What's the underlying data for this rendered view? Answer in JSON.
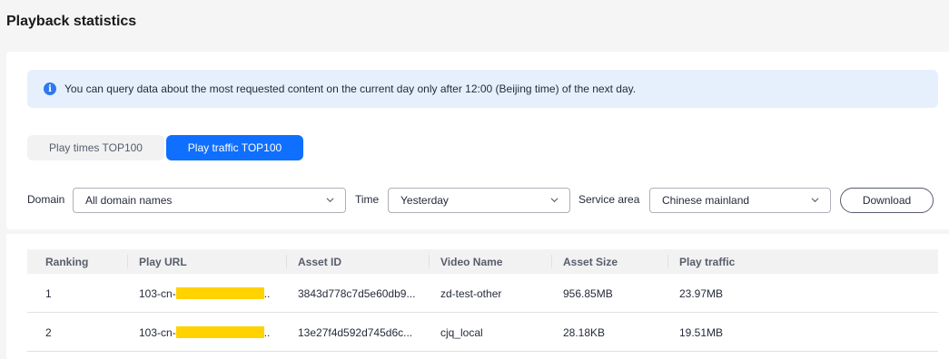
{
  "page": {
    "title": "Playback statistics"
  },
  "notice": {
    "icon": "info-icon",
    "text": "You can query data about the most requested content on the current day only after 12:00 (Beijing time) of the next day."
  },
  "tabs": [
    {
      "label": "Play times TOP100",
      "active": false
    },
    {
      "label": "Play traffic TOP100",
      "active": true
    }
  ],
  "filters": {
    "domain_label": "Domain",
    "domain_value": "All domain names",
    "time_label": "Time",
    "time_value": "Yesterday",
    "area_label": "Service area",
    "area_value": "Chinese mainland",
    "download_label": "Download"
  },
  "table": {
    "columns": [
      "Ranking",
      "Play URL",
      "Asset ID",
      "Video Name",
      "Asset Size",
      "Play traffic"
    ],
    "rows": [
      {
        "ranking": "1",
        "url_prefix": "103-cn-",
        "url_suffix": "..",
        "asset_id": "3843d778c7d5e60db9...",
        "video_name": "zd-test-other",
        "asset_size": "956.85MB",
        "play_traffic": "23.97MB"
      },
      {
        "ranking": "2",
        "url_prefix": "103-cn-",
        "url_suffix": "..",
        "asset_id": "13e27f4d592d745d6c...",
        "video_name": "cjq_local",
        "asset_size": "28.18KB",
        "play_traffic": "19.51MB"
      }
    ]
  },
  "colors": {
    "accent": "#0f6fff",
    "notice_bg": "#e6f0fd",
    "redaction": "#ffd200"
  }
}
